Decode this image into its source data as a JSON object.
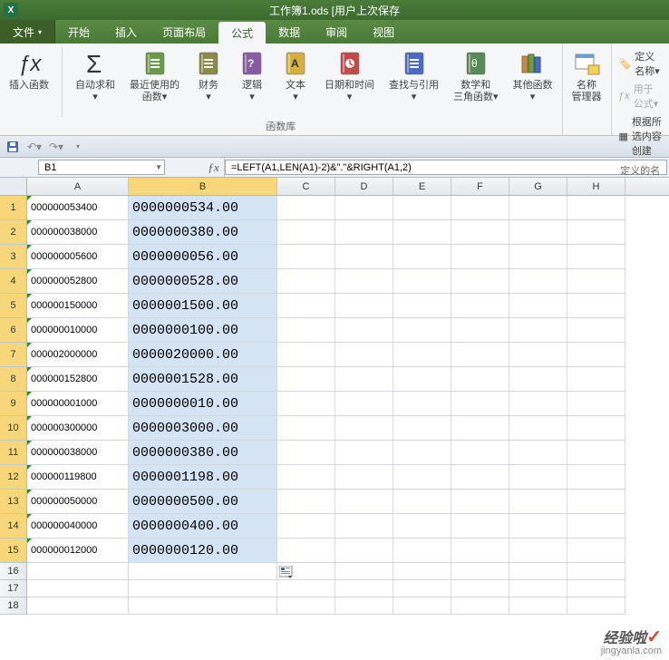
{
  "title": "工作簿1.ods [用户上次保存",
  "menu": {
    "file": "文件",
    "tabs": [
      "开始",
      "插入",
      "页面布局",
      "公式",
      "数据",
      "审阅",
      "视图"
    ],
    "active": 3
  },
  "ribbon": {
    "items": [
      {
        "label": "插入函数",
        "icon": "fx"
      },
      {
        "label": "自动求和\n▾",
        "icon": "sigma"
      },
      {
        "label": "最近使用的\n函数▾",
        "icon": "book-green"
      },
      {
        "label": "财务\n▾",
        "icon": "book-olive"
      },
      {
        "label": "逻辑\n▾",
        "icon": "book-purple"
      },
      {
        "label": "文本\n▾",
        "icon": "book-yellow"
      },
      {
        "label": "日期和时间\n▾",
        "icon": "book-red"
      },
      {
        "label": "查找与引用\n▾",
        "icon": "book-blue"
      },
      {
        "label": "数学和\n三角函数▾",
        "icon": "book-theta"
      },
      {
        "label": "其他函数\n▾",
        "icon": "books"
      }
    ],
    "group1_label": "函数库",
    "name_mgr": "名称\n管理器",
    "right": [
      "定义名称▾",
      "用于公式▾",
      "根据所选内容创建"
    ],
    "group2_label": "定义的名称"
  },
  "name_box": "B1",
  "formula": "=LEFT(A1,LEN(A1)-2)&\".\"&RIGHT(A1,2)",
  "columns": [
    "A",
    "B",
    "C",
    "D",
    "E",
    "F",
    "G",
    "H"
  ],
  "chart_data": {
    "type": "table",
    "columns": [
      "A",
      "B"
    ],
    "rows": [
      [
        "000000053400",
        "0000000534.00"
      ],
      [
        "000000038000",
        "0000000380.00"
      ],
      [
        "000000005600",
        "0000000056.00"
      ],
      [
        "000000052800",
        "0000000528.00"
      ],
      [
        "000000150000",
        "0000001500.00"
      ],
      [
        "000000010000",
        "0000000100.00"
      ],
      [
        "000002000000",
        "0000020000.00"
      ],
      [
        "000000152800",
        "0000001528.00"
      ],
      [
        "000000001000",
        "0000000010.00"
      ],
      [
        "000000300000",
        "0000003000.00"
      ],
      [
        "000000038000",
        "0000000380.00"
      ],
      [
        "000000119800",
        "0000001198.00"
      ],
      [
        "000000050000",
        "0000000500.00"
      ],
      [
        "000000040000",
        "0000000400.00"
      ],
      [
        "000000012000",
        "0000000120.00"
      ]
    ]
  },
  "watermark": {
    "big": "经验啦",
    "small": "jingyanla.com"
  }
}
